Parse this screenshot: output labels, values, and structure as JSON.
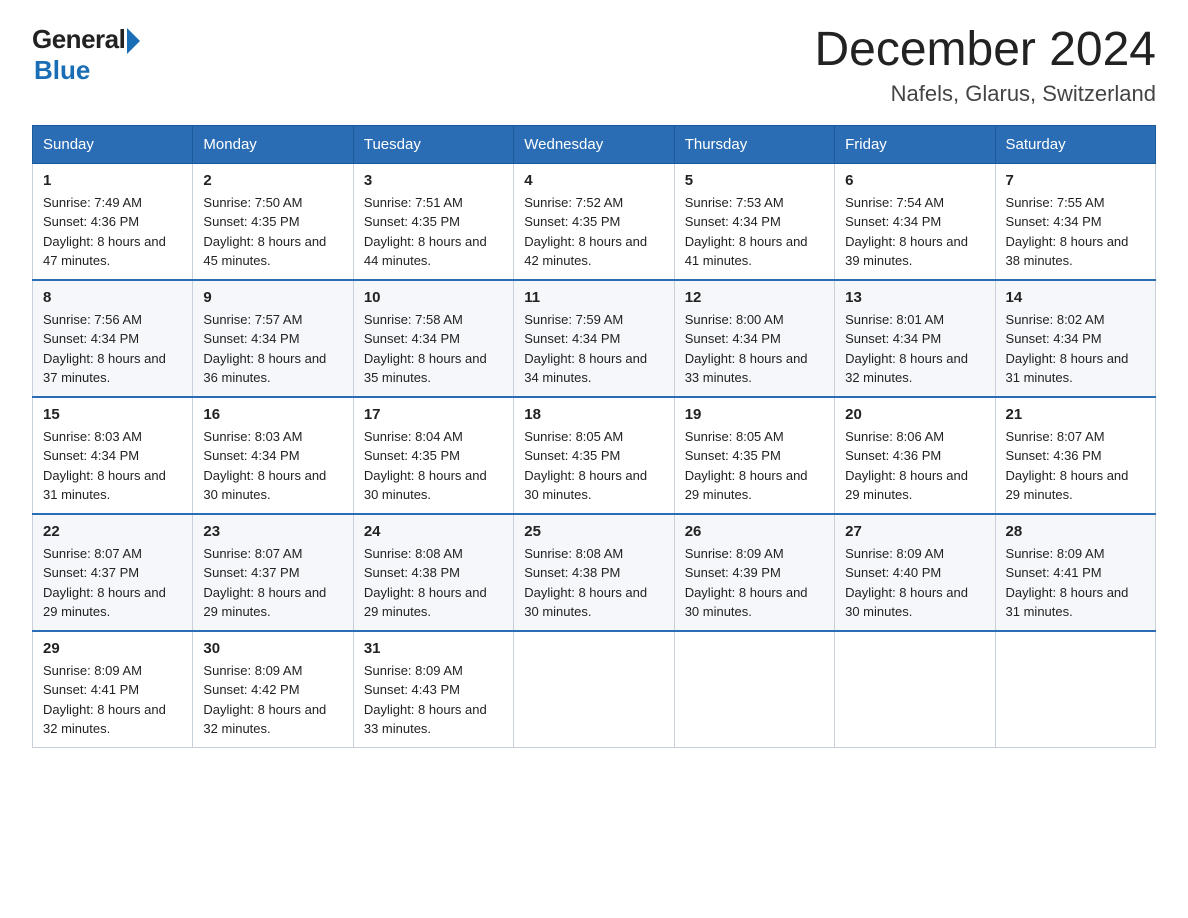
{
  "header": {
    "logo": {
      "general": "General",
      "blue": "Blue"
    },
    "title": "December 2024",
    "subtitle": "Nafels, Glarus, Switzerland"
  },
  "calendar": {
    "days_of_week": [
      "Sunday",
      "Monday",
      "Tuesday",
      "Wednesday",
      "Thursday",
      "Friday",
      "Saturday"
    ],
    "weeks": [
      [
        {
          "day": "1",
          "sunrise": "7:49 AM",
          "sunset": "4:36 PM",
          "daylight": "8 hours and 47 minutes."
        },
        {
          "day": "2",
          "sunrise": "7:50 AM",
          "sunset": "4:35 PM",
          "daylight": "8 hours and 45 minutes."
        },
        {
          "day": "3",
          "sunrise": "7:51 AM",
          "sunset": "4:35 PM",
          "daylight": "8 hours and 44 minutes."
        },
        {
          "day": "4",
          "sunrise": "7:52 AM",
          "sunset": "4:35 PM",
          "daylight": "8 hours and 42 minutes."
        },
        {
          "day": "5",
          "sunrise": "7:53 AM",
          "sunset": "4:34 PM",
          "daylight": "8 hours and 41 minutes."
        },
        {
          "day": "6",
          "sunrise": "7:54 AM",
          "sunset": "4:34 PM",
          "daylight": "8 hours and 39 minutes."
        },
        {
          "day": "7",
          "sunrise": "7:55 AM",
          "sunset": "4:34 PM",
          "daylight": "8 hours and 38 minutes."
        }
      ],
      [
        {
          "day": "8",
          "sunrise": "7:56 AM",
          "sunset": "4:34 PM",
          "daylight": "8 hours and 37 minutes."
        },
        {
          "day": "9",
          "sunrise": "7:57 AM",
          "sunset": "4:34 PM",
          "daylight": "8 hours and 36 minutes."
        },
        {
          "day": "10",
          "sunrise": "7:58 AM",
          "sunset": "4:34 PM",
          "daylight": "8 hours and 35 minutes."
        },
        {
          "day": "11",
          "sunrise": "7:59 AM",
          "sunset": "4:34 PM",
          "daylight": "8 hours and 34 minutes."
        },
        {
          "day": "12",
          "sunrise": "8:00 AM",
          "sunset": "4:34 PM",
          "daylight": "8 hours and 33 minutes."
        },
        {
          "day": "13",
          "sunrise": "8:01 AM",
          "sunset": "4:34 PM",
          "daylight": "8 hours and 32 minutes."
        },
        {
          "day": "14",
          "sunrise": "8:02 AM",
          "sunset": "4:34 PM",
          "daylight": "8 hours and 31 minutes."
        }
      ],
      [
        {
          "day": "15",
          "sunrise": "8:03 AM",
          "sunset": "4:34 PM",
          "daylight": "8 hours and 31 minutes."
        },
        {
          "day": "16",
          "sunrise": "8:03 AM",
          "sunset": "4:34 PM",
          "daylight": "8 hours and 30 minutes."
        },
        {
          "day": "17",
          "sunrise": "8:04 AM",
          "sunset": "4:35 PM",
          "daylight": "8 hours and 30 minutes."
        },
        {
          "day": "18",
          "sunrise": "8:05 AM",
          "sunset": "4:35 PM",
          "daylight": "8 hours and 30 minutes."
        },
        {
          "day": "19",
          "sunrise": "8:05 AM",
          "sunset": "4:35 PM",
          "daylight": "8 hours and 29 minutes."
        },
        {
          "day": "20",
          "sunrise": "8:06 AM",
          "sunset": "4:36 PM",
          "daylight": "8 hours and 29 minutes."
        },
        {
          "day": "21",
          "sunrise": "8:07 AM",
          "sunset": "4:36 PM",
          "daylight": "8 hours and 29 minutes."
        }
      ],
      [
        {
          "day": "22",
          "sunrise": "8:07 AM",
          "sunset": "4:37 PM",
          "daylight": "8 hours and 29 minutes."
        },
        {
          "day": "23",
          "sunrise": "8:07 AM",
          "sunset": "4:37 PM",
          "daylight": "8 hours and 29 minutes."
        },
        {
          "day": "24",
          "sunrise": "8:08 AM",
          "sunset": "4:38 PM",
          "daylight": "8 hours and 29 minutes."
        },
        {
          "day": "25",
          "sunrise": "8:08 AM",
          "sunset": "4:38 PM",
          "daylight": "8 hours and 30 minutes."
        },
        {
          "day": "26",
          "sunrise": "8:09 AM",
          "sunset": "4:39 PM",
          "daylight": "8 hours and 30 minutes."
        },
        {
          "day": "27",
          "sunrise": "8:09 AM",
          "sunset": "4:40 PM",
          "daylight": "8 hours and 30 minutes."
        },
        {
          "day": "28",
          "sunrise": "8:09 AM",
          "sunset": "4:41 PM",
          "daylight": "8 hours and 31 minutes."
        }
      ],
      [
        {
          "day": "29",
          "sunrise": "8:09 AM",
          "sunset": "4:41 PM",
          "daylight": "8 hours and 32 minutes."
        },
        {
          "day": "30",
          "sunrise": "8:09 AM",
          "sunset": "4:42 PM",
          "daylight": "8 hours and 32 minutes."
        },
        {
          "day": "31",
          "sunrise": "8:09 AM",
          "sunset": "4:43 PM",
          "daylight": "8 hours and 33 minutes."
        },
        null,
        null,
        null,
        null
      ]
    ]
  }
}
